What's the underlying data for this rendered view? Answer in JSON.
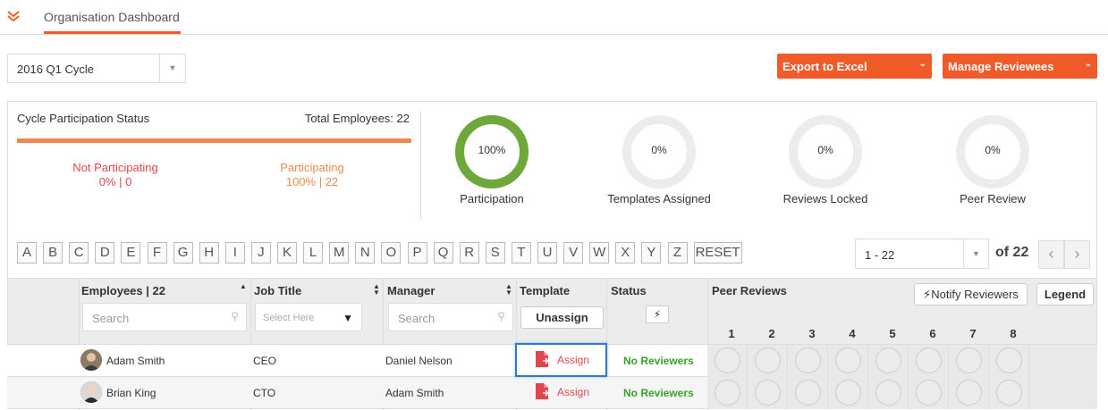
{
  "header": {
    "tab_label": "Organisation Dashboard"
  },
  "cycle": {
    "selected": "2016 Q1 Cycle"
  },
  "actions": {
    "export_label": "Export to Excel",
    "manage_label": "Manage Reviewees"
  },
  "participation": {
    "title": "Cycle Participation Status",
    "total": "Total Employees: 22",
    "not_participating_label": "Not Participating",
    "not_participating_value": "0% | 0",
    "participating_label": "Participating",
    "participating_value": "100% | 22"
  },
  "donuts": [
    {
      "value": "100%",
      "label": "Participation",
      "fraction": 1.0,
      "color": "#6ea83a"
    },
    {
      "value": "0%",
      "label": "Templates Assigned",
      "fraction": 0,
      "color": "#6ea83a"
    },
    {
      "value": "0%",
      "label": "Reviews Locked",
      "fraction": 0,
      "color": "#6ea83a"
    },
    {
      "value": "0%",
      "label": "Peer Review",
      "fraction": 0,
      "color": "#6ea83a"
    }
  ],
  "alphabet": [
    "A",
    "B",
    "C",
    "D",
    "E",
    "F",
    "G",
    "H",
    "I",
    "J",
    "K",
    "L",
    "M",
    "N",
    "O",
    "P",
    "Q",
    "R",
    "S",
    "T",
    "U",
    "V",
    "W",
    "X",
    "Y",
    "Z"
  ],
  "reset_label": "RESET",
  "pagination": {
    "range": "1 - 22",
    "of_total": "of 22"
  },
  "table": {
    "headers": {
      "employees": "Employees | 22",
      "job_title": "Job Title",
      "manager": "Manager",
      "template": "Template",
      "status": "Status",
      "peer_reviews": "Peer Reviews"
    },
    "search_placeholder": "Search",
    "select_placeholder": "Select Here",
    "unassign_label": "Unassign",
    "notify_label": "Notify Reviewers",
    "legend_label": "Legend",
    "peer_columns": [
      "1",
      "2",
      "3",
      "4",
      "5",
      "6",
      "7",
      "8"
    ],
    "rows": [
      {
        "name": "Adam Smith",
        "job": "CEO",
        "manager": "Daniel Nelson",
        "template": "Assign",
        "status": "No Reviewers"
      },
      {
        "name": "Brian King",
        "job": "CTO",
        "manager": "Adam Smith",
        "template": "Assign",
        "status": "No Reviewers"
      }
    ]
  },
  "colors": {
    "accent": "#f15a29",
    "success": "#3aa12a",
    "danger": "#e0474c",
    "focus": "#2d7bd1"
  }
}
